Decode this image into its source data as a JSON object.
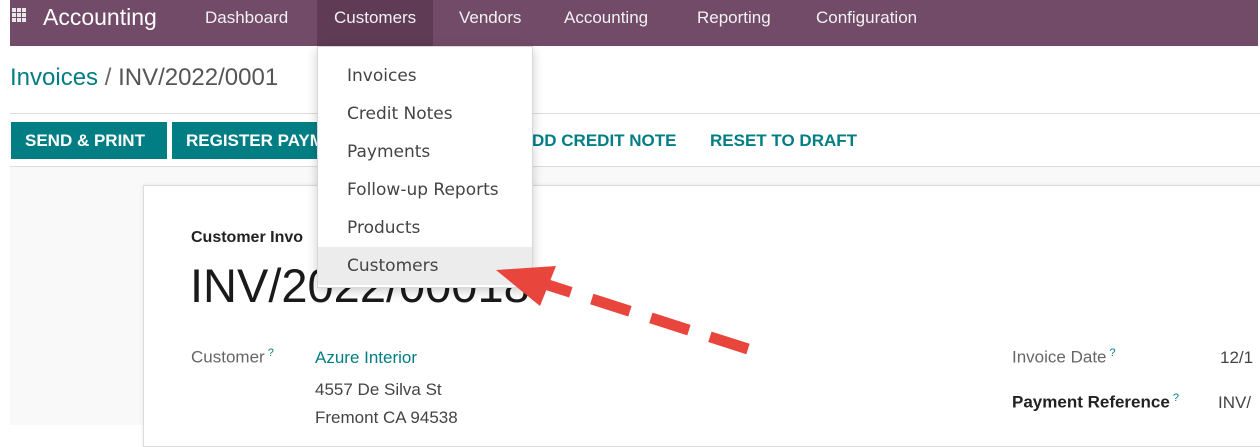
{
  "navbar": {
    "app_name": "Accounting",
    "menus": [
      "Dashboard",
      "Customers",
      "Vendors",
      "Accounting",
      "Reporting",
      "Configuration"
    ],
    "active_menu": "Customers",
    "color": "#714B67"
  },
  "breadcrumb": {
    "parent": "Invoices",
    "separator": "/",
    "current": "INV/2022/0001"
  },
  "toolbar": {
    "send_print": "SEND & PRINT",
    "register_payment": "REGISTER PAYM",
    "add_credit_note": "DD CREDIT NOTE",
    "reset_to_draft": "RESET TO DRAFT"
  },
  "dropdown": {
    "items": [
      "Invoices",
      "Credit Notes",
      "Payments",
      "Follow-up Reports",
      "Products",
      "Customers"
    ],
    "highlighted": "Customers"
  },
  "invoice": {
    "type": "Customer Invo",
    "number": "INV/2022/00018",
    "customer_label": "Customer",
    "customer_name": "Azure Interior",
    "address_line1": "4557 De Silva St",
    "address_line2": "Fremont CA 94538",
    "invoice_date_label": "Invoice Date",
    "invoice_date_value": "12/1",
    "payment_ref_label": "Payment Reference",
    "payment_ref_value": "INV/",
    "help_mark": "?"
  },
  "colors": {
    "accent": "#017e84",
    "annotation_arrow": "#e8453c"
  }
}
